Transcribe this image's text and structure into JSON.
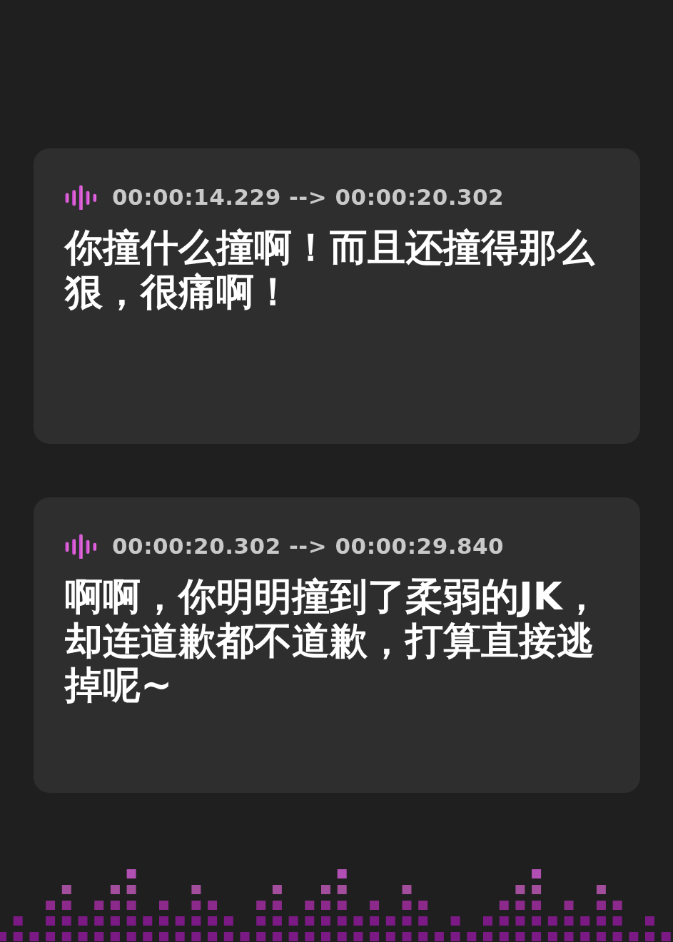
{
  "cards": [
    {
      "timestamp": "00:00:14.229 --> 00:00:20.302",
      "text": "你撞什么撞啊！而且还撞得那么狠，很痛啊！"
    },
    {
      "timestamp": "00:00:20.302 --> 00:00:29.840",
      "text": "啊啊，你明明撞到了柔弱的JK，却连道歉都不道歉，打算直接逃掉呢~"
    }
  ]
}
